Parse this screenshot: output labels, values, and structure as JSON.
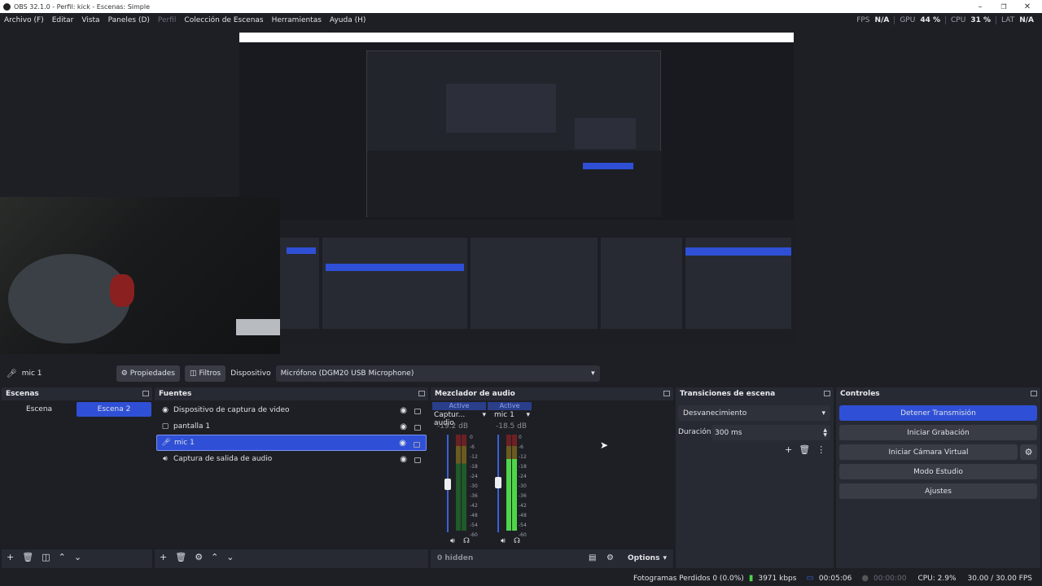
{
  "window": {
    "title": "OBS 32.1.0 - Perfil: kick - Escenas: Simple",
    "minimize": "–",
    "maximize": "❐",
    "close": "✕"
  },
  "menu": [
    {
      "label": "Archivo (F)"
    },
    {
      "label": "Editar"
    },
    {
      "label": "Vista"
    },
    {
      "label": "Paneles (D)"
    },
    {
      "label": "Perfil",
      "disabled": true
    },
    {
      "label": "Colección de Escenas"
    },
    {
      "label": "Herramientas"
    },
    {
      "label": "Ayuda (H)"
    }
  ],
  "stats": {
    "fps_label": "FPS",
    "fps": "N/A",
    "gpu_label": "GPU",
    "gpu": "44 %",
    "cpu_label": "CPU",
    "cpu": "31 %",
    "lat_label": "LAT",
    "lat": "N/A"
  },
  "propbar": {
    "source": "mic 1",
    "properties": "Propiedades",
    "filters": "Filtros",
    "device_label": "Dispositivo",
    "device": "Micrófono (DGM20 USB Microphone)"
  },
  "scenes": {
    "title": "Escenas",
    "items": [
      "Escena",
      "Escena 2"
    ],
    "selected": 1
  },
  "sources": {
    "title": "Fuentes",
    "items": [
      {
        "name": "Dispositivo de captura de video",
        "icon": "camera-icon"
      },
      {
        "name": "pantalla 1",
        "icon": "monitor-icon"
      },
      {
        "name": "mic 1",
        "icon": "microphone-icon"
      },
      {
        "name": "Captura de salida de audio",
        "icon": "speaker-icon"
      }
    ],
    "selected": 2
  },
  "mixer": {
    "title": "Mezclador de audio",
    "channels": [
      {
        "status": "Active",
        "name": "Captur... audio",
        "db": "-19.2 dB",
        "fader": 0.5,
        "level": 0.0
      },
      {
        "status": "Active",
        "name": "mic 1",
        "db": "-18.5 dB",
        "fader": 0.5,
        "level": 0.75
      }
    ],
    "scale": [
      "0",
      "-6",
      "-12",
      "-18",
      "-24",
      "-30",
      "-36",
      "-42",
      "-48",
      "-54",
      "-60"
    ],
    "hidden": "0 hidden",
    "options": "Options"
  },
  "transitions": {
    "title": "Transiciones de escena",
    "type": "Desvanecimiento",
    "duration_label": "Duración",
    "duration": "300 ms"
  },
  "controls": {
    "title": "Controles",
    "stop_stream": "Detener Transmisión",
    "start_record": "Iniciar Grabación",
    "start_vcam": "Iniciar Cámara Virtual",
    "studio_mode": "Modo Estudio",
    "settings": "Ajustes"
  },
  "status": {
    "dropped": "Fotogramas Perdidos 0 (0.0%)",
    "bitrate": "3971 kbps",
    "stream_time": "00:05:06",
    "rec_time": "00:00:00",
    "cpu": "CPU: 2.9%",
    "fps": "30.00 / 30.00 FPS"
  },
  "colors": {
    "accent": "#2f50d6",
    "panel": "#272a33",
    "background": "#1e1f25",
    "meter_green": "#4fd54a"
  }
}
